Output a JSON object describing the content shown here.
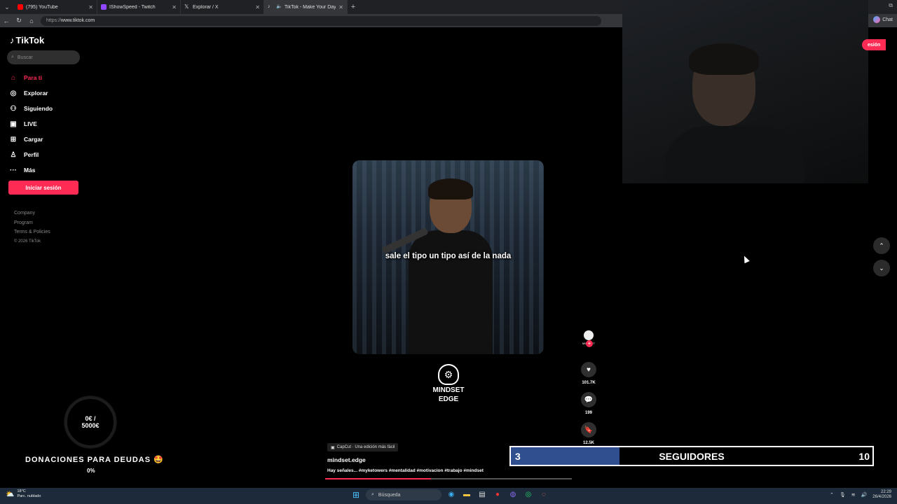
{
  "browser": {
    "tabs": [
      {
        "label": "(795) YouTube",
        "color": "#ff0000",
        "active": false
      },
      {
        "label": "IShowSpeed - Twitch",
        "color": "#9146ff",
        "active": false
      },
      {
        "label": "Explorar / X",
        "color": "#ffffff",
        "active": false
      },
      {
        "label": "TikTok - Make Your Day",
        "color": "#ffffff",
        "active": true
      }
    ],
    "url": "www.tiktok.com",
    "url_proto": "https://",
    "chat_label": "Chat"
  },
  "tiktok": {
    "logo": "TikTok",
    "search_placeholder": "Buscar",
    "nav": [
      {
        "label": "Para ti",
        "icon": "home-icon",
        "active": true
      },
      {
        "label": "Explorar",
        "icon": "compass-icon",
        "active": false
      },
      {
        "label": "Siguiendo",
        "icon": "following-icon",
        "active": false
      },
      {
        "label": "LIVE",
        "icon": "live-icon",
        "active": false
      },
      {
        "label": "Cargar",
        "icon": "upload-icon",
        "active": false
      },
      {
        "label": "Perfil",
        "icon": "profile-icon",
        "active": false
      },
      {
        "label": "Más",
        "icon": "more-icon",
        "active": false
      }
    ],
    "login_button": "Iniciar sesión",
    "login_button_partial": "esión",
    "footer": {
      "company": "Company",
      "program": "Program",
      "terms": "Terms & Policies",
      "copyright": "© 2026 TikTok"
    },
    "video": {
      "caption": "sale el tipo un tipo así de la nada",
      "brand": [
        "MINDSET",
        "EDGE"
      ],
      "capcut": "CapCut · Una edición más fácil",
      "username": "mindset.edge",
      "description": "Hay señales... #myketowers #mentalidad #motivacion #trabajo #mindset",
      "progress": 0.43,
      "avatar_label": "MINDSET"
    },
    "actions": [
      {
        "icon": "heart-icon",
        "count": "101.7K"
      },
      {
        "icon": "comment-icon",
        "count": "199"
      },
      {
        "icon": "bookmark-icon",
        "count": "12.5K"
      }
    ]
  },
  "donations": {
    "amount": "0€ /",
    "goal": "5000€",
    "title": "DONACIONES PARA DEUDAS 🤩",
    "percent": "0%"
  },
  "followers_goal": {
    "current": "3",
    "label": "SEGUIDORES",
    "goal": "10",
    "fill_fraction": 0.3,
    "fill_color": "#2f4f8f"
  },
  "taskbar": {
    "weather_temp": "18°C",
    "weather_desc": "Parc. nublado",
    "search": "Búsqueda",
    "time": "22:29",
    "date": "26/4/2026"
  }
}
